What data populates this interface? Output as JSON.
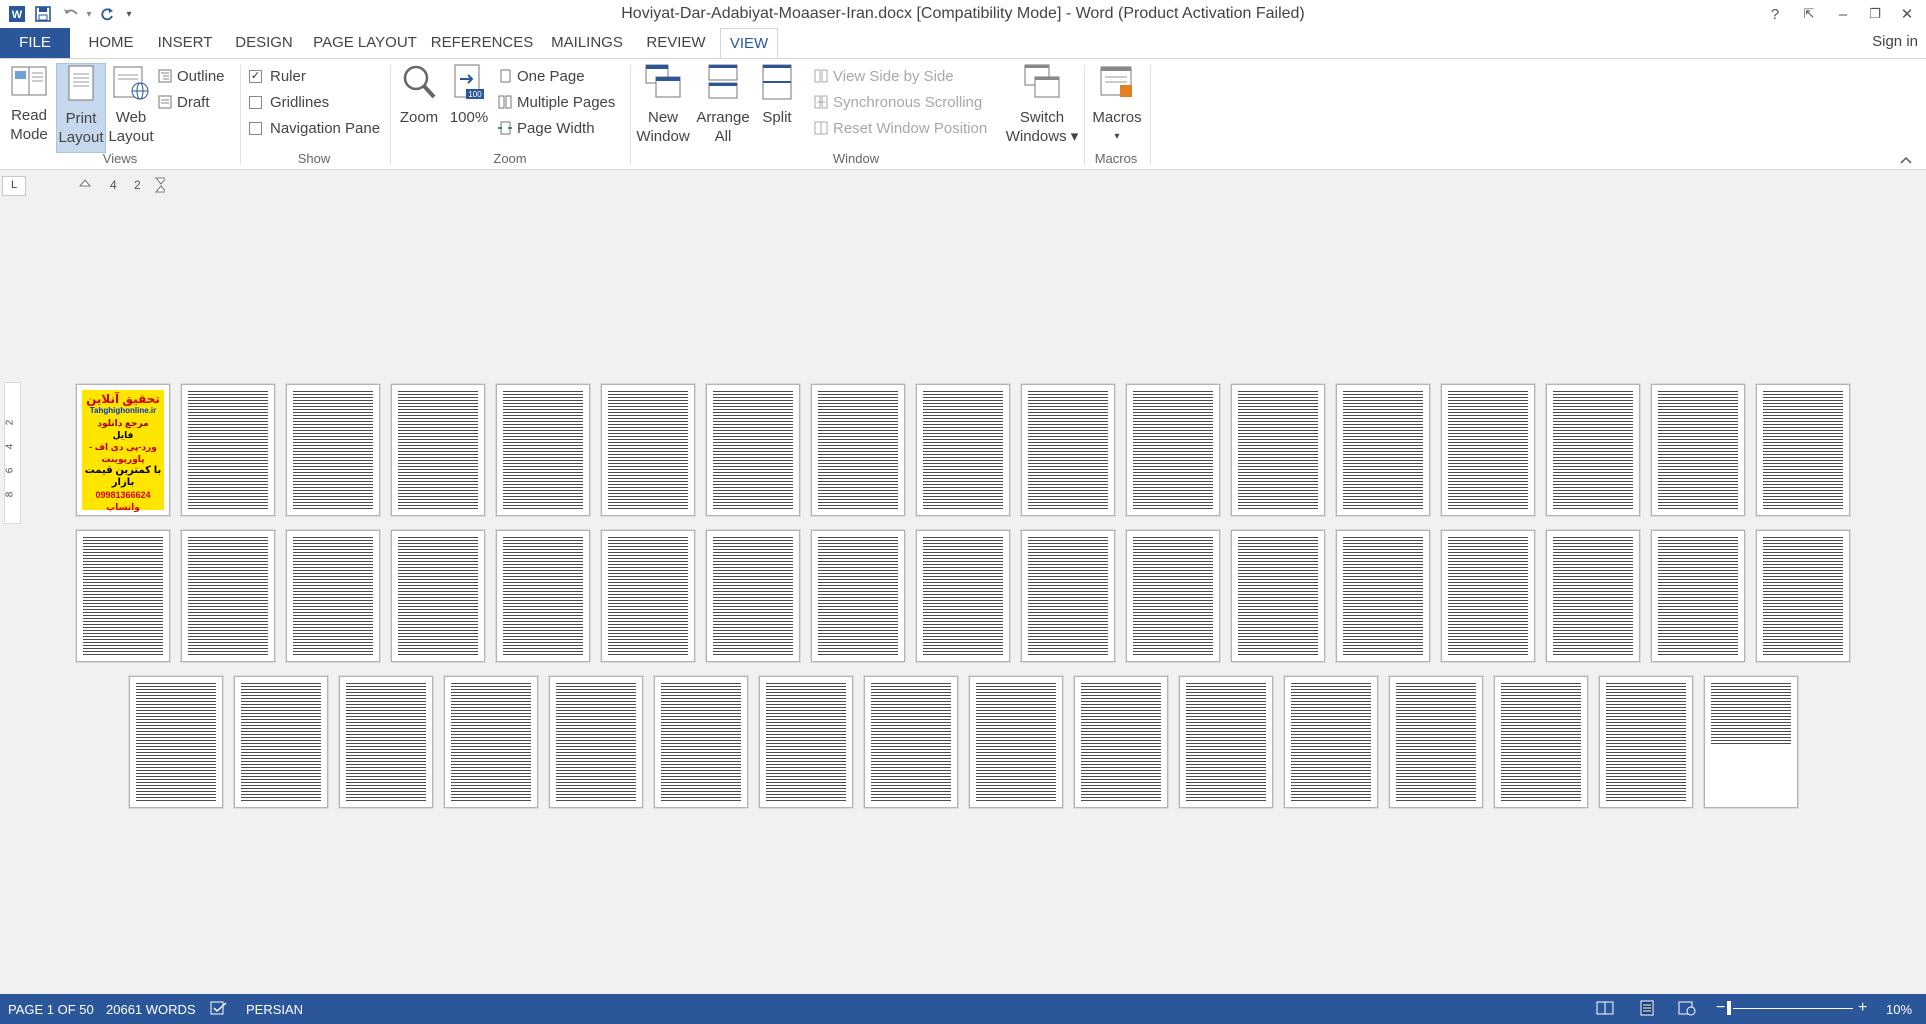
{
  "app": {
    "title": "Hoviyat-Dar-Adabiyat-Moaaser-Iran.docx [Compatibility Mode] - Word (Product Activation Failed)",
    "help": "?",
    "minimize": "–",
    "restore": "❐",
    "close": "✕",
    "ribbon_display": "⇱",
    "sign_in": "Sign in"
  },
  "qat": {
    "undo_dropdown": "▾",
    "customize": "▾"
  },
  "tabs": [
    "FILE",
    "HOME",
    "INSERT",
    "DESIGN",
    "PAGE LAYOUT",
    "REFERENCES",
    "MAILINGS",
    "REVIEW",
    "VIEW"
  ],
  "active_tab": "VIEW",
  "ribbon": {
    "views": {
      "label": "Views",
      "read_mode": [
        "Read",
        "Mode"
      ],
      "print_layout": [
        "Print",
        "Layout"
      ],
      "web_layout": [
        "Web",
        "Layout"
      ],
      "outline": "Outline",
      "draft": "Draft"
    },
    "show": {
      "label": "Show",
      "ruler": "Ruler",
      "ruler_checked": "✓",
      "gridlines": "Gridlines",
      "navigation_pane": "Navigation Pane"
    },
    "zoom": {
      "label": "Zoom",
      "zoom": "Zoom",
      "hundred": "100%",
      "hundred_icon_text": "100",
      "one_page": "One Page",
      "multiple_pages": "Multiple Pages",
      "page_width": "Page Width"
    },
    "window": {
      "label": "Window",
      "new_window": [
        "New",
        "Window"
      ],
      "arrange_all": [
        "Arrange",
        "All"
      ],
      "split": "Split",
      "view_side_by_side": "View Side by Side",
      "synchronous_scrolling": "Synchronous Scrolling",
      "reset_window_position": "Reset Window Position",
      "switch_windows": [
        "Switch",
        "Windows ▾"
      ]
    },
    "macros": {
      "label": "Macros",
      "macros": "Macros",
      "macros_arrow": "▾"
    }
  },
  "ruler": {
    "tab_selector": "L",
    "h_numbers": [
      "4",
      "2"
    ],
    "v_numbers": [
      "2",
      "4",
      "6",
      "8"
    ]
  },
  "cover_page": {
    "lines": [
      "تحقیق آنلاین",
      "Tahghighonline.ir",
      "مرجع دانلود",
      "فایل",
      "ورد-پی دی اف - پاورپوینت",
      "با کمترین قیمت بازار",
      "09981366624 واتساپ"
    ]
  },
  "status": {
    "page": "PAGE 1 OF 50",
    "words": "20661 WORDS",
    "language": "PERSIAN",
    "zoom_minus": "−",
    "zoom_plus": "+",
    "zoom_level": "10%"
  },
  "colors": {
    "accent": "#2b579a",
    "cover_bg": "#ffe600"
  },
  "page_count": 50
}
